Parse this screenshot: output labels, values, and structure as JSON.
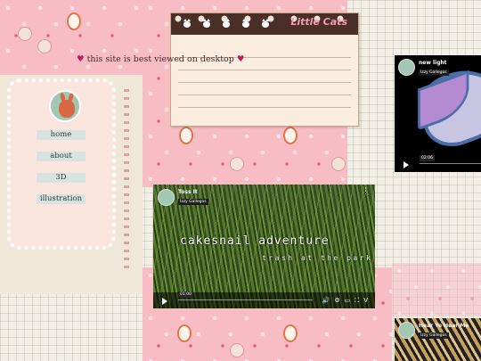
{
  "banner": {
    "heart_left": "♥",
    "text": "this site is best viewed on desktop",
    "heart_right": "♥"
  },
  "notebook": {
    "title": "Little Cats"
  },
  "nav": {
    "items": [
      {
        "label": "home"
      },
      {
        "label": "about"
      },
      {
        "label": "3D"
      },
      {
        "label": "illustration"
      }
    ]
  },
  "videos": {
    "main": {
      "title": "Toss It",
      "author": "Izzy Gallegos",
      "overlay_title": "cakesnail adventure",
      "overlay_subtitle": "trash at the park",
      "time": "01:00"
    },
    "new_light": {
      "title": "new light",
      "author": "Izzy Gallegos",
      "time": "02:06"
    },
    "hear_ye": {
      "title": "Hear Ye Hear Me",
      "author": "Izzy Gallegos"
    }
  },
  "icons": {
    "kebab": "⋮",
    "volume": "🔊",
    "settings": "⚙",
    "pip": "▭",
    "fullscreen": "⛶",
    "vimeo": "V"
  },
  "colors": {
    "pink_bg": "#f7bcc4",
    "paper_bg": "#f2efe6",
    "nav_bg": "#d6e3e1",
    "card_bg": "#fbe6df",
    "notebook_brown": "#4a2f28",
    "title_pink": "#f49ab0"
  }
}
